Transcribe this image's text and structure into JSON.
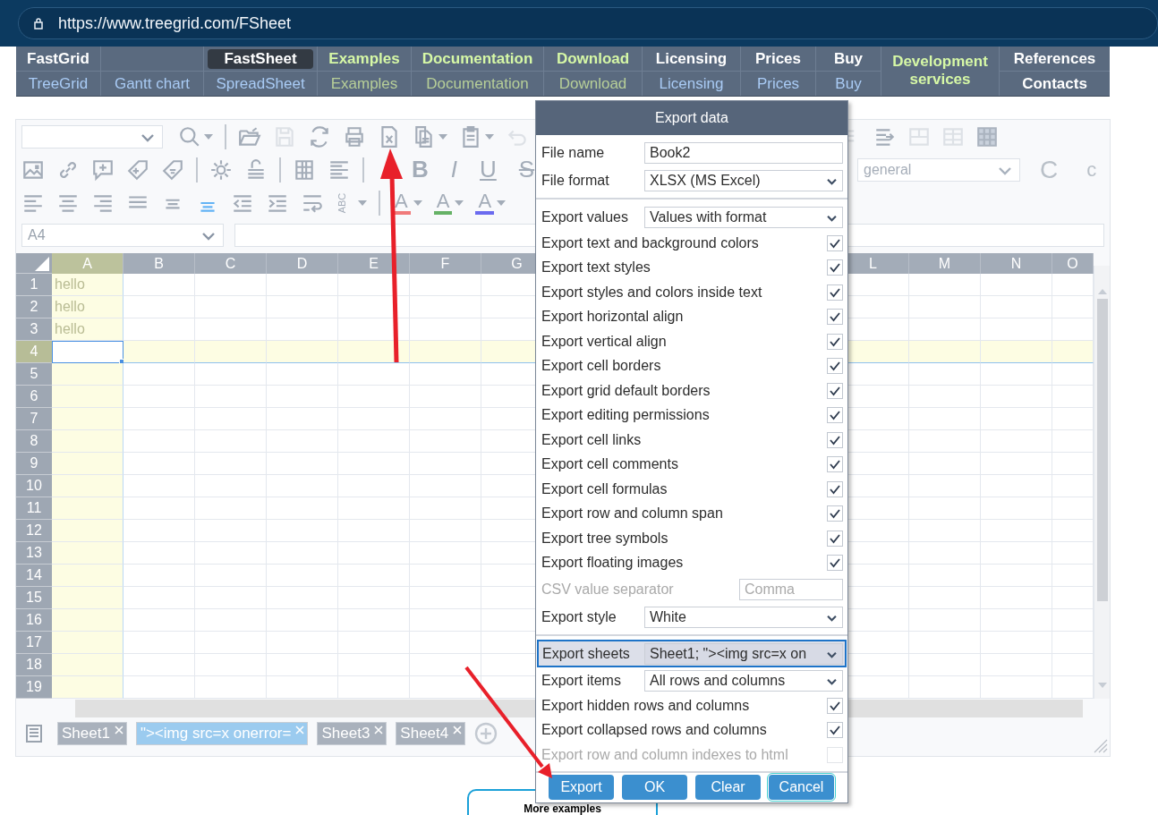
{
  "browser": {
    "url": "https://www.treegrid.com/FSheet"
  },
  "nav": {
    "columns": [
      {
        "top": {
          "label": "FastGrid",
          "kind": "main"
        },
        "bottom": {
          "label": "TreeGrid",
          "kind": "link"
        }
      },
      {
        "bottom": {
          "label": "Gantt chart",
          "kind": "link"
        }
      },
      {
        "top": {
          "label": "FastSheet",
          "kind": "current"
        },
        "bottom": {
          "label": "SpreadSheet",
          "kind": "link"
        }
      },
      {
        "top": {
          "label": "Examples",
          "kind": "featured"
        },
        "bottom": {
          "label": "Examples",
          "kind": "muted"
        }
      },
      {
        "top": {
          "label": "Documentation",
          "kind": "featured"
        },
        "bottom": {
          "label": "Documentation",
          "kind": "muted"
        }
      },
      {
        "top": {
          "label": "Download",
          "kind": "featured"
        },
        "bottom": {
          "label": "Download",
          "kind": "muted"
        }
      },
      {
        "top": {
          "label": "Licensing",
          "kind": "main"
        },
        "bottom": {
          "label": "Licensing",
          "kind": "link"
        }
      },
      {
        "top": {
          "label": "Prices",
          "kind": "main"
        },
        "bottom": {
          "label": "Prices",
          "kind": "link"
        }
      },
      {
        "top": {
          "label": "Buy",
          "kind": "main"
        },
        "bottom": {
          "label": "Buy",
          "kind": "link"
        }
      },
      {
        "merged": {
          "label": "Development services",
          "kind": "featured"
        }
      },
      {
        "top": {
          "label": "References",
          "kind": "main"
        },
        "bottom": {
          "label": "Contacts",
          "kind": "main"
        }
      }
    ]
  },
  "sheet": {
    "name_box": "A4",
    "number_format": "general",
    "style_buttons": [
      "B",
      "I",
      "U",
      "S"
    ],
    "rotate_button": "ABC",
    "color_buttons": [
      {
        "glyph": "A",
        "color": "#f07a7a"
      },
      {
        "glyph": "A",
        "color": "#66b266"
      },
      {
        "glyph": "A",
        "color": "#6b6bef"
      }
    ],
    "decimal_buttons": [
      "C",
      "c"
    ],
    "columns_left": [
      {
        "label": "A",
        "selected": true
      },
      {
        "label": "B",
        "selected": false
      },
      {
        "label": "C",
        "selected": false
      },
      {
        "label": "D",
        "selected": false
      },
      {
        "label": "E",
        "selected": false
      },
      {
        "label": "F",
        "selected": false
      },
      {
        "label": "G",
        "selected": false
      }
    ],
    "columns_right": [
      {
        "label": "L",
        "selected": false
      },
      {
        "label": "M",
        "selected": false
      },
      {
        "label": "N",
        "selected": false
      },
      {
        "label": "O",
        "selected": false
      }
    ],
    "rows": [
      {
        "label": "1",
        "selected": false,
        "value": "hello"
      },
      {
        "label": "2",
        "selected": false,
        "value": "hello"
      },
      {
        "label": "3",
        "selected": false,
        "value": "hello"
      },
      {
        "label": "4",
        "selected": true
      },
      {
        "label": "5",
        "selected": false
      },
      {
        "label": "6",
        "selected": false
      },
      {
        "label": "7",
        "selected": false
      },
      {
        "label": "8",
        "selected": false
      },
      {
        "label": "9",
        "selected": false
      },
      {
        "label": "10",
        "selected": false
      },
      {
        "label": "11",
        "selected": false
      },
      {
        "label": "12",
        "selected": false
      },
      {
        "label": "13",
        "selected": false
      },
      {
        "label": "14",
        "selected": false
      },
      {
        "label": "15",
        "selected": false
      },
      {
        "label": "16",
        "selected": false
      },
      {
        "label": "17",
        "selected": false
      },
      {
        "label": "18",
        "selected": false
      },
      {
        "label": "19",
        "selected": false
      }
    ],
    "tabs": [
      {
        "label": "Sheet1",
        "selected": false
      },
      {
        "label": "\"><img src=x onerror=",
        "selected": true
      },
      {
        "label": "Sheet3",
        "selected": false
      },
      {
        "label": "Sheet4",
        "selected": false
      }
    ]
  },
  "dialog": {
    "title": "Export data",
    "sections": [
      {
        "rows": [
          {
            "kind": "input",
            "label": "File name",
            "value": "Book2",
            "disabled": false,
            "focused": false
          },
          {
            "kind": "select",
            "label": "File format",
            "value": "XLSX (MS Excel)",
            "disabled": false,
            "focused": false
          }
        ]
      },
      {
        "rows": [
          {
            "kind": "select",
            "label": "Export values",
            "value": "Values with format",
            "disabled": false,
            "focused": false
          },
          {
            "kind": "check",
            "label": "Export text and background colors",
            "checked": true,
            "disabled": false,
            "focused": false
          },
          {
            "kind": "check",
            "label": "Export text styles",
            "checked": true,
            "disabled": false,
            "focused": false
          },
          {
            "kind": "check",
            "label": "Export styles and colors inside text",
            "checked": true,
            "disabled": false,
            "focused": false
          },
          {
            "kind": "check",
            "label": "Export horizontal align",
            "checked": true,
            "disabled": false,
            "focused": false
          },
          {
            "kind": "check",
            "label": "Export vertical align",
            "checked": true,
            "disabled": false,
            "focused": false
          },
          {
            "kind": "check",
            "label": "Export cell borders",
            "checked": true,
            "disabled": false,
            "focused": false
          },
          {
            "kind": "check",
            "label": "Export grid default borders",
            "checked": true,
            "disabled": false,
            "focused": false
          },
          {
            "kind": "check",
            "label": "Export editing permissions",
            "checked": true,
            "disabled": false,
            "focused": false
          },
          {
            "kind": "check",
            "label": "Export cell links",
            "checked": true,
            "disabled": false,
            "focused": false
          },
          {
            "kind": "check",
            "label": "Export cell comments",
            "checked": true,
            "disabled": false,
            "focused": false
          },
          {
            "kind": "check",
            "label": "Export cell formulas",
            "checked": true,
            "disabled": false,
            "focused": false
          },
          {
            "kind": "check",
            "label": "Export row and column span",
            "checked": true,
            "disabled": false,
            "focused": false
          },
          {
            "kind": "check",
            "label": "Export tree symbols",
            "checked": true,
            "disabled": false,
            "focused": false
          },
          {
            "kind": "check",
            "label": "Export floating images",
            "checked": true,
            "disabled": false,
            "focused": false
          },
          {
            "kind": "input",
            "label": "CSV value separator",
            "value": "Comma",
            "disabled": true,
            "focused": false
          },
          {
            "kind": "select",
            "label": "Export style",
            "value": "White",
            "disabled": false,
            "focused": false
          }
        ]
      },
      {
        "rows": [
          {
            "kind": "select",
            "label": "Export sheets",
            "value": "Sheet1; \"><img src=x on",
            "disabled": false,
            "focused": true
          },
          {
            "kind": "select",
            "label": "Export items",
            "value": "All rows and columns",
            "disabled": false,
            "focused": false
          },
          {
            "kind": "check",
            "label": "Export hidden rows and columns",
            "checked": true,
            "disabled": false,
            "focused": false
          },
          {
            "kind": "check",
            "label": "Export collapsed rows and columns",
            "checked": true,
            "disabled": false,
            "focused": false
          },
          {
            "kind": "check",
            "label": "Export row and column indexes to html",
            "checked": false,
            "disabled": true,
            "focused": false
          }
        ]
      }
    ],
    "buttons": [
      {
        "label": "Export",
        "focused": false
      },
      {
        "label": "OK",
        "focused": false
      },
      {
        "label": "Clear",
        "focused": false
      },
      {
        "label": "Cancel",
        "focused": true
      }
    ]
  },
  "more_examples": "More examples"
}
